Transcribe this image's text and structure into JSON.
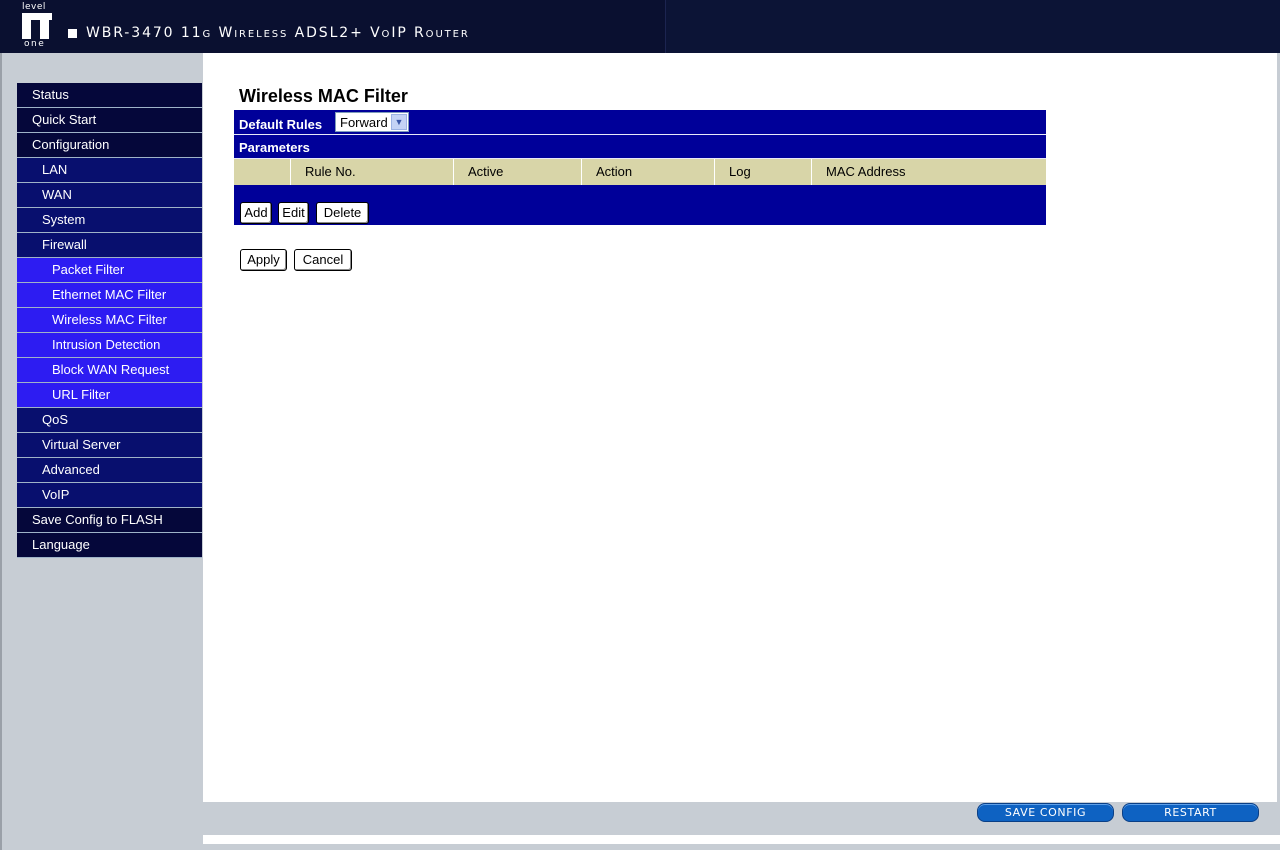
{
  "header": {
    "logo_top": "level",
    "logo_bottom": "one",
    "product_title": "WBR-3470 11g Wireless ADSL2+ VoIP Router"
  },
  "menu": [
    {
      "label": "Status",
      "level": 1
    },
    {
      "label": "Quick Start",
      "level": 1
    },
    {
      "label": "Configuration",
      "level": 1
    },
    {
      "label": "LAN",
      "level": 2
    },
    {
      "label": "WAN",
      "level": 2
    },
    {
      "label": "System",
      "level": 2
    },
    {
      "label": "Firewall",
      "level": 2
    },
    {
      "label": "Packet Filter",
      "level": 3
    },
    {
      "label": "Ethernet MAC Filter",
      "level": 3
    },
    {
      "label": "Wireless MAC Filter",
      "level": 3
    },
    {
      "label": "Intrusion Detection",
      "level": 3
    },
    {
      "label": "Block WAN Request",
      "level": 3
    },
    {
      "label": "URL Filter",
      "level": 3
    },
    {
      "label": "QoS",
      "level": 2
    },
    {
      "label": "Virtual Server",
      "level": 2
    },
    {
      "label": "Advanced",
      "level": 2
    },
    {
      "label": "VoIP",
      "level": 2
    },
    {
      "label": "Save Config to FLASH",
      "level": 1
    },
    {
      "label": "Language",
      "level": 1
    }
  ],
  "main": {
    "title": "Wireless MAC Filter",
    "default_rules_label": "Default Rules",
    "default_rules_value": "Forward",
    "parameters_label": "Parameters",
    "columns": [
      "Rule No.",
      "Active",
      "Action",
      "Log",
      "MAC Address"
    ],
    "rows": [],
    "buttons": {
      "add": "Add",
      "edit": "Edit",
      "delete": "Delete",
      "apply": "Apply",
      "cancel": "Cancel"
    }
  },
  "footer": {
    "save_config": "SAVE CONFIG",
    "restart": "RESTART"
  },
  "colors": {
    "header_bg": "#0a1030",
    "menu_level1": "#05073a",
    "menu_level2": "#080f6e",
    "menu_level3": "#2d1cf2",
    "panel_bg": "#000099",
    "table_header_bg": "#d8d5a8",
    "footer_button": "#0e62c2"
  }
}
